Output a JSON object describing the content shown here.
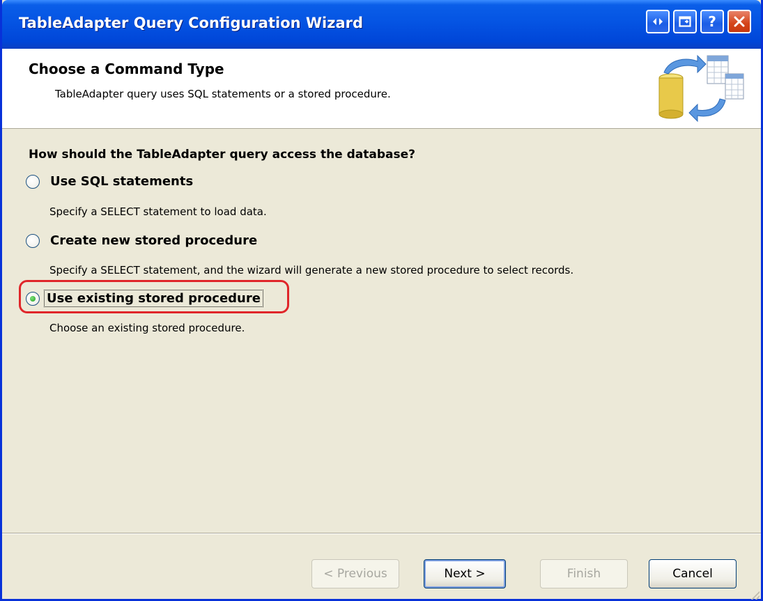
{
  "window": {
    "title": "TableAdapter Query Configuration Wizard",
    "title_buttons": [
      "context-help-toggle-icon",
      "restore-icon",
      "help-icon",
      "close-icon"
    ]
  },
  "header": {
    "title": "Choose a Command Type",
    "subtitle": "TableAdapter query uses SQL statements or a stored procedure."
  },
  "content": {
    "question": "How should the TableAdapter query access the database?",
    "options": [
      {
        "label": "Use SQL statements",
        "description": "Specify a SELECT statement to load data.",
        "checked": false
      },
      {
        "label": "Create new stored procedure",
        "description": "Specify a SELECT statement, and the wizard will generate a new stored procedure to select records.",
        "checked": false
      },
      {
        "label": "Use existing stored procedure",
        "description": "Choose an existing stored procedure.",
        "checked": true
      }
    ]
  },
  "footer": {
    "previous": "< Previous",
    "next": "Next >",
    "finish": "Finish",
    "cancel": "Cancel"
  },
  "colors": {
    "titlebar": "#0554e3",
    "dialog_bg": "#ece9d8",
    "highlight": "#e0262a",
    "radio_dot": "#21a121"
  }
}
